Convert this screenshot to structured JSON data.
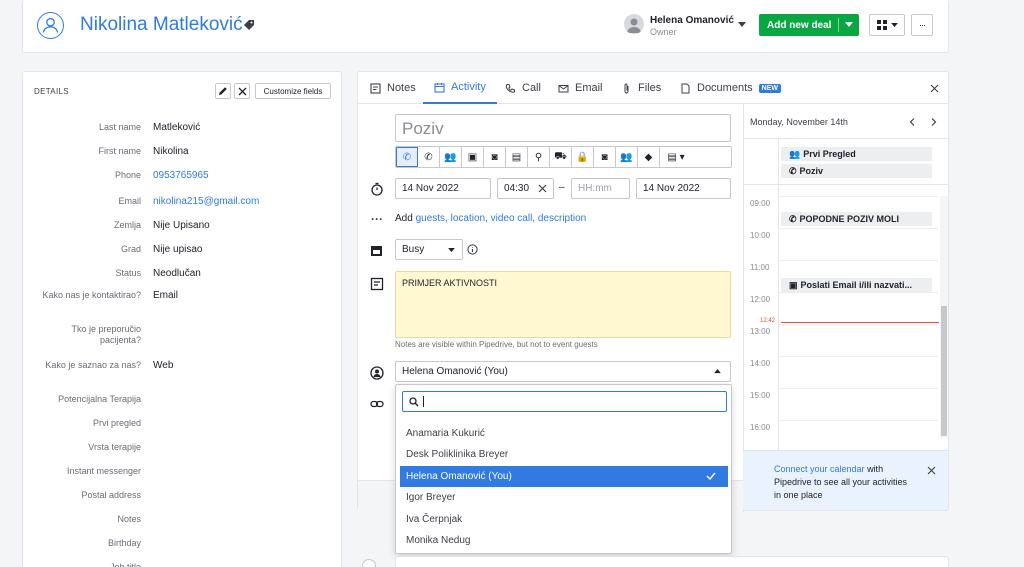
{
  "header": {
    "person_name": "Nikolina Matleković",
    "user_name": "Helena Omanović",
    "user_role": "Owner",
    "add_deal_label": "Add new deal",
    "more_label": "···"
  },
  "details": {
    "title": "DETAILS",
    "customize_label": "Customize fields",
    "fields": [
      {
        "label": "Last name",
        "value": "Matleković"
      },
      {
        "label": "First name",
        "value": "Nikolina"
      },
      {
        "label": "Phone",
        "value": "0953765965"
      },
      {
        "label": "Email",
        "value": "nikolina215@gmail.com"
      },
      {
        "label": "Zemlja",
        "value": "Nije Upisano"
      },
      {
        "label": "Grad",
        "value": "Nije upisao"
      },
      {
        "label": "Status",
        "value": "Neodlučan"
      },
      {
        "label": "Kako nas je kontaktirao?",
        "value": "Email"
      },
      {
        "label": "Tko je preporučio pacijenta?",
        "value": ""
      },
      {
        "label": "Kako je saznao za nas?",
        "value": "Web"
      },
      {
        "label": "Potencijalna Terapija",
        "value": ""
      },
      {
        "label": "Prvi pregled",
        "value": ""
      },
      {
        "label": "Vrsta terapije",
        "value": ""
      },
      {
        "label": "Instant messenger",
        "value": ""
      },
      {
        "label": "Postal address",
        "value": ""
      },
      {
        "label": "Notes",
        "value": ""
      },
      {
        "label": "Birthday",
        "value": ""
      },
      {
        "label": "Job title",
        "value": ""
      }
    ]
  },
  "tabs": {
    "notes": "Notes",
    "activity": "Activity",
    "call": "Call",
    "email": "Email",
    "files": "Files",
    "documents": "Documents",
    "new_badge": "NEW"
  },
  "activity": {
    "subject": "Poziv",
    "start_date": "14 Nov 2022",
    "start_time": "04:30",
    "end_time_placeholder": "HH:mm",
    "end_date": "14 Nov 2022",
    "dash": "–",
    "add_prefix": "Add ",
    "add_links": "guests, location, video call, description",
    "busy": "Busy",
    "note_text": "PRIMJER AKTIVNOSTI",
    "note_hint": "Notes are visible within Pipedrive, but not to event guests",
    "assignee": "Helena Omanović (You)"
  },
  "dropdown": {
    "search_value": "",
    "options": [
      "Anamaria Kukurić",
      "Desk Poliklinika Breyer",
      "Helena Omanović (You)",
      "Igor Breyer",
      "Iva Čerpnjak",
      "Monika Nedug"
    ],
    "selected_index": 2
  },
  "calendar": {
    "date_label": "Monday, November 14th",
    "allday_events": [
      "Prvi Pregled",
      "Poziv"
    ],
    "hours": [
      "09:00",
      "10:00",
      "11:00",
      "12:00",
      "13:00",
      "14:00",
      "15:00",
      "16:00"
    ],
    "events": [
      "POPODNE POZIV MOLI",
      "Poslati Email i/ili nazvati..."
    ],
    "now_label": "12:42",
    "connect_link": "Connect your calendar",
    "connect_rest": " with Pipedrive to see all your activities in one place"
  },
  "colors": {
    "accent": "#317ae2",
    "primary_green": "#08a742",
    "note_bg": "#fff8d0"
  }
}
